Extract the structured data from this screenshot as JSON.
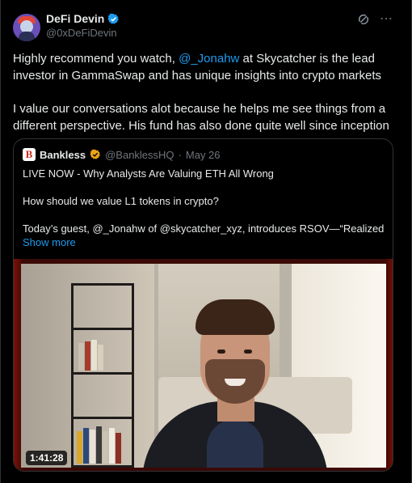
{
  "author": {
    "display_name": "DeFi Devin",
    "handle": "@0xDeFiDevin",
    "verified_color": "#1d9bf0",
    "avatar_icon": "avatar-cartoon"
  },
  "actions": {
    "grok_icon": "grok-icon",
    "more_icon": "⋯"
  },
  "tweet": {
    "para1_before": "Highly recommend you watch, ",
    "para1_mention": "@_Jonahw",
    "para1_after": " at Skycatcher is the lead investor in GammaSwap and has unique insights into crypto markets",
    "para2": "I value our conversations alot because he helps me see things from a different perspective. His fund has also done quite well since inception"
  },
  "quote": {
    "logo_letter": "B",
    "name": "Bankless",
    "handle": "@BanklessHQ",
    "separator": "·",
    "date": "May 26",
    "verified_color": "#e8a317",
    "line1": "LIVE NOW - Why Analysts Are Valuing ETH All Wrong",
    "line2": "How should we value L1 tokens in crypto?",
    "line3": "Today’s guest,  @_Jonahw  of @skycatcher_xyz, introduces RSOV—“Realized ...",
    "show_more": "Show more",
    "video_duration": "1:41:28"
  },
  "colors": {
    "link": "#1d9bf0",
    "muted": "#71767b",
    "text": "#e7e9ea",
    "background": "#000000"
  }
}
